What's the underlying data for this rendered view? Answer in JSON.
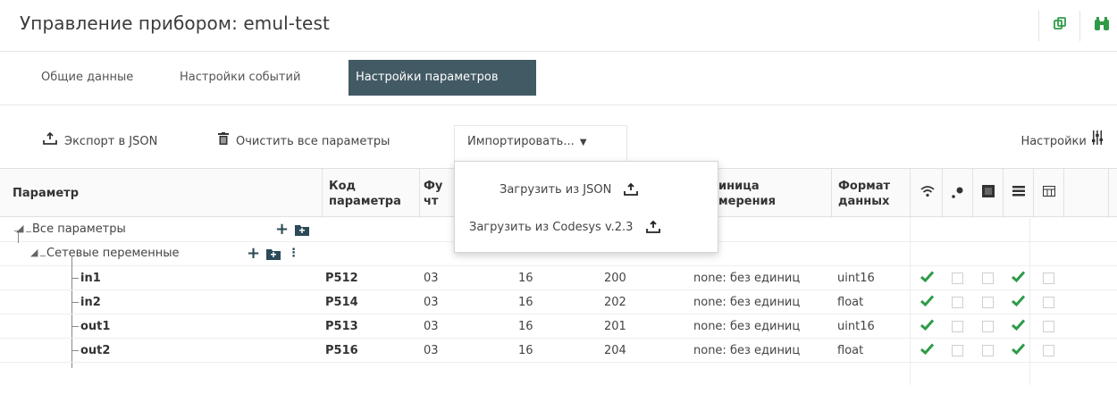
{
  "header": {
    "title": "Управление прибором: emul-test",
    "icons": [
      "copy-icon",
      "binoculars-icon"
    ]
  },
  "tabs": [
    {
      "label": "Общие данные",
      "active": false
    },
    {
      "label": "Настройки событий",
      "active": false
    },
    {
      "label": "Настройки параметров",
      "active": true
    }
  ],
  "toolbar": {
    "export_label": "Экспорт в JSON",
    "clear_label": "Очистить все параметры",
    "import_label": "Импортировать...",
    "settings_label": "Настройки"
  },
  "dropdown": {
    "items": [
      {
        "label": "Загрузить из JSON"
      },
      {
        "label": "Загрузить из Codesys v.2.3"
      }
    ]
  },
  "table": {
    "columns": {
      "param": "Параметр",
      "code": "Код параметра",
      "func": "Фу чт",
      "unit": "иница мерения",
      "format": "Формат данных"
    },
    "tree": {
      "root": "Все параметры",
      "group": "Сетевые переменные"
    },
    "rows": [
      {
        "name": "in1",
        "code": "P512",
        "func": "03",
        "reg": "16",
        "addr": "200",
        "unit": "none: без единиц",
        "format": "uint16",
        "checks": [
          true,
          false,
          false,
          true,
          false
        ]
      },
      {
        "name": "in2",
        "code": "P514",
        "func": "03",
        "reg": "16",
        "addr": "202",
        "unit": "none: без единиц",
        "format": "float",
        "checks": [
          true,
          false,
          false,
          true,
          false
        ]
      },
      {
        "name": "out1",
        "code": "P513",
        "func": "03",
        "reg": "16",
        "addr": "201",
        "unit": "none: без единиц",
        "format": "uint16",
        "checks": [
          true,
          false,
          false,
          true,
          false
        ]
      },
      {
        "name": "out2",
        "code": "P516",
        "func": "03",
        "reg": "16",
        "addr": "204",
        "unit": "none: без единиц",
        "format": "float",
        "checks": [
          true,
          false,
          false,
          true,
          false
        ]
      }
    ]
  },
  "colors": {
    "accent": "#425a64",
    "check": "#2e9b47"
  }
}
